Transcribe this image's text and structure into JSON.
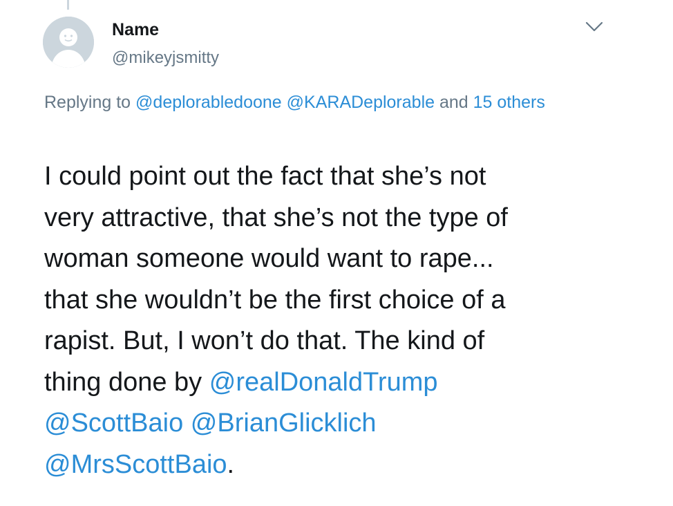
{
  "tweet": {
    "author_name": "Name",
    "author_handle": "@mikeyjsmitty",
    "avatar_icon": "default-avatar-egg-icon",
    "menu_icon": "chevron-down-icon",
    "replying": {
      "prefix": "Replying to ",
      "mention_1": "@deplorabledoone",
      "mention_2": "@KARADeplorable",
      "and_label": " and ",
      "others_link": "15 others"
    },
    "body": {
      "line_1": "I could point out the fact that she’s not",
      "line_2": "very attractive, that she’s not the type of",
      "line_3": "woman someone would want to rape...",
      "line_4": "that she wouldn’t be the first choice of a",
      "line_5": "rapist. But, I won’t do that. The kind of",
      "line_6_prefix": "thing done by ",
      "mention_trump": "@realDonaldTrump",
      "mention_baio": "@ScottBaio",
      "mention_glicklich": "@BrianGlicklich",
      "mention_mrsbaio": "@MrsScottBaio",
      "final_period": "."
    }
  },
  "colors": {
    "text": "#14171a",
    "secondary": "#657786",
    "link": "#2b8dd6",
    "avatar_bg": "#ccd6dd",
    "avatar_fg": "#ffffff"
  }
}
